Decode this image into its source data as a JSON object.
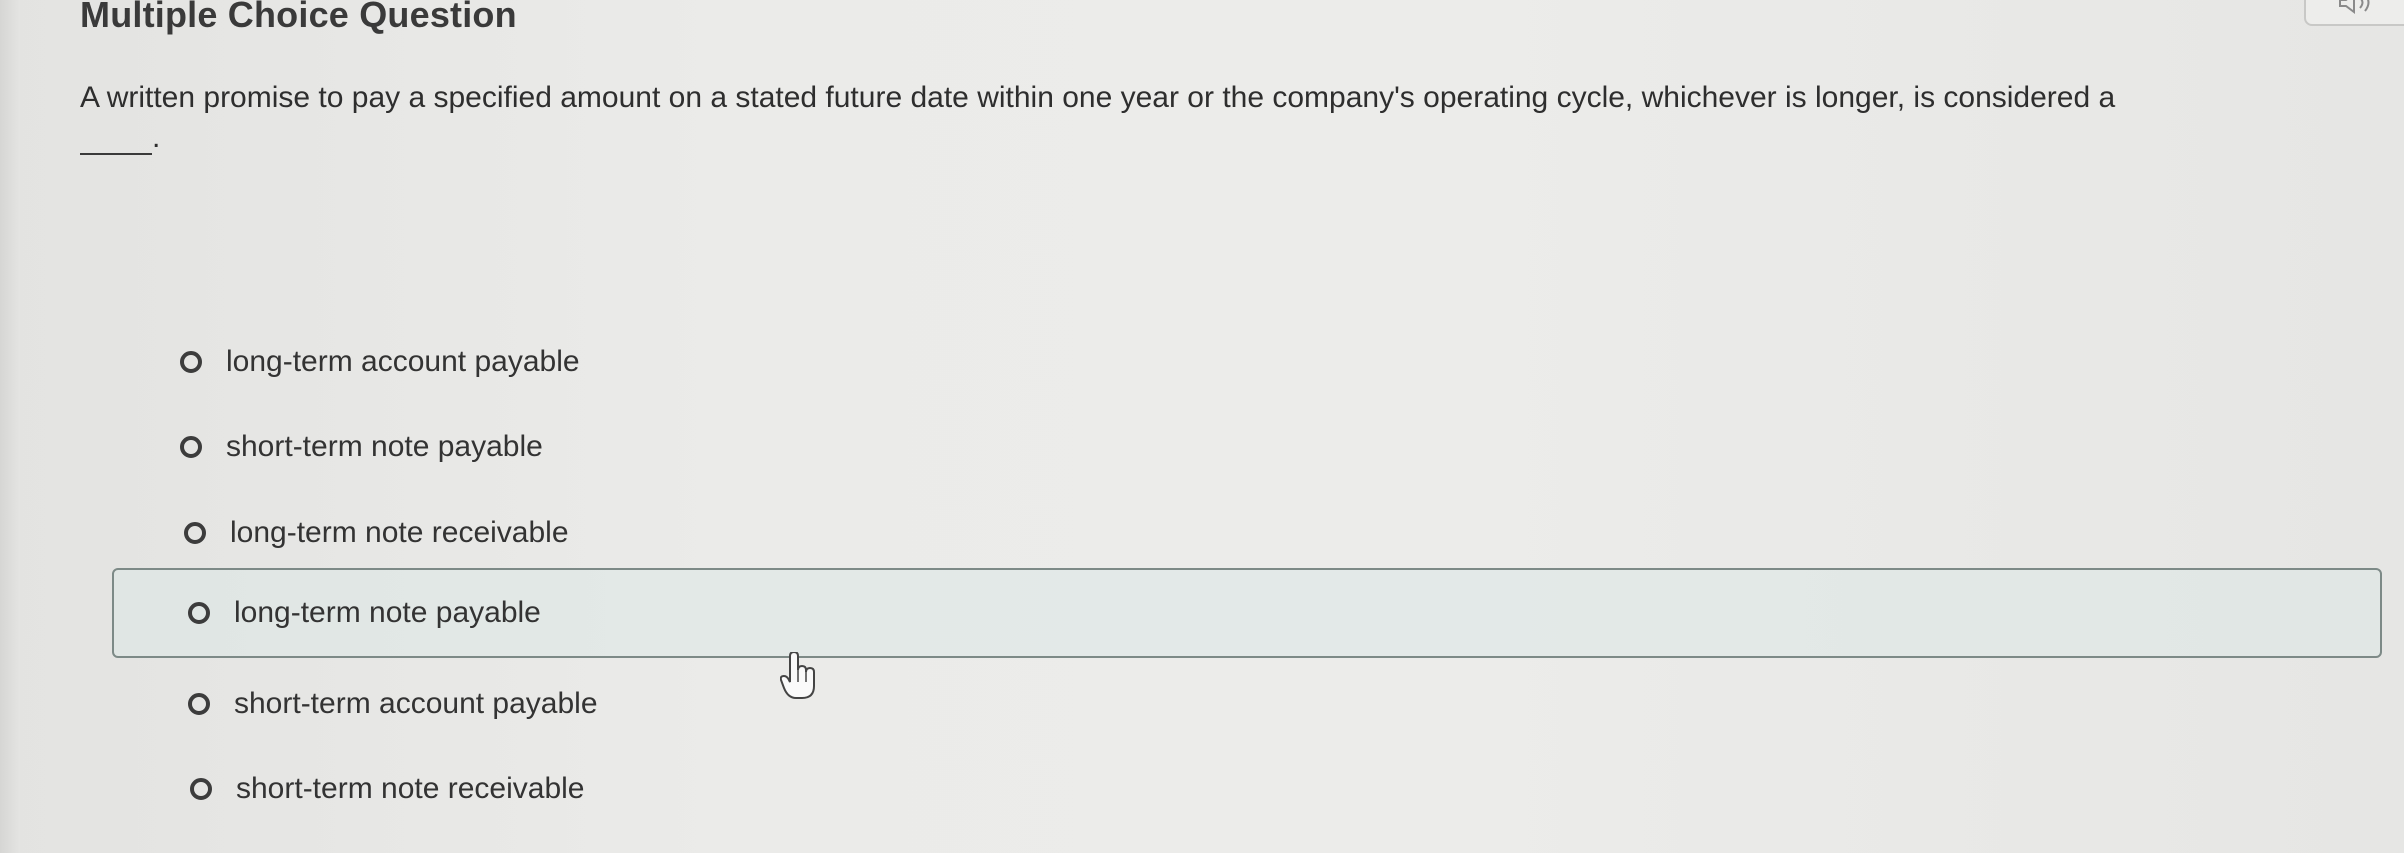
{
  "header": {
    "title": "Multiple Choice Question"
  },
  "toolbar": {
    "audio_icon": "speaker-icon"
  },
  "question": {
    "text": "A written promise to pay a specified amount on a stated future date within one year or the company's operating cycle, whichever is longer, is considered a",
    "blank_suffix": "."
  },
  "options": [
    {
      "label": "long-term account payable",
      "selected": false,
      "highlighted": false
    },
    {
      "label": "short-term note payable",
      "selected": false,
      "highlighted": false
    },
    {
      "label": "long-term note receivable",
      "selected": false,
      "highlighted": false
    },
    {
      "label": "long-term note payable",
      "selected": false,
      "highlighted": true
    },
    {
      "label": "short-term account payable",
      "selected": false,
      "highlighted": false
    },
    {
      "label": "short-term note receivable",
      "selected": false,
      "highlighted": false
    }
  ],
  "colors": {
    "highlight_border": "#7d8a87",
    "highlight_fill": "#dce8e6",
    "text": "#2e2e2e",
    "background": "#ebebe9"
  }
}
